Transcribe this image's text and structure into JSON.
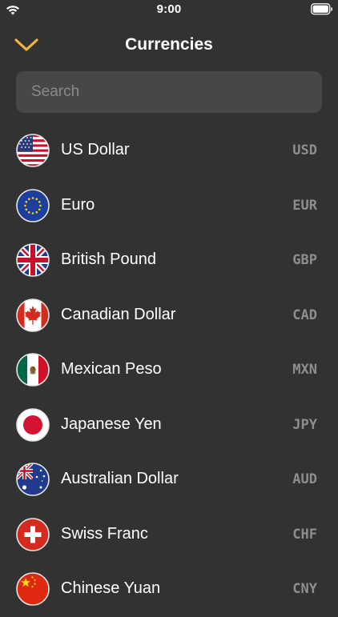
{
  "status_bar": {
    "time": "9:00"
  },
  "nav": {
    "title": "Currencies",
    "back_icon": "chevron-down-icon",
    "accent_color": "#f0b53c"
  },
  "search": {
    "placeholder": "Search",
    "value": ""
  },
  "currencies": [
    {
      "name": "US Dollar",
      "code": "USD",
      "flag": "us-flag-icon"
    },
    {
      "name": "Euro",
      "code": "EUR",
      "flag": "eu-flag-icon"
    },
    {
      "name": "British Pound",
      "code": "GBP",
      "flag": "gb-flag-icon"
    },
    {
      "name": "Canadian Dollar",
      "code": "CAD",
      "flag": "ca-flag-icon"
    },
    {
      "name": "Mexican Peso",
      "code": "MXN",
      "flag": "mx-flag-icon"
    },
    {
      "name": "Japanese Yen",
      "code": "JPY",
      "flag": "jp-flag-icon"
    },
    {
      "name": "Australian Dollar",
      "code": "AUD",
      "flag": "au-flag-icon"
    },
    {
      "name": "Swiss Franc",
      "code": "CHF",
      "flag": "ch-flag-icon"
    },
    {
      "name": "Chinese Yuan",
      "code": "CNY",
      "flag": "cn-flag-icon"
    }
  ],
  "colors": {
    "background": "#323232",
    "search_background": "#474747",
    "code_text": "#8e8e8e"
  }
}
